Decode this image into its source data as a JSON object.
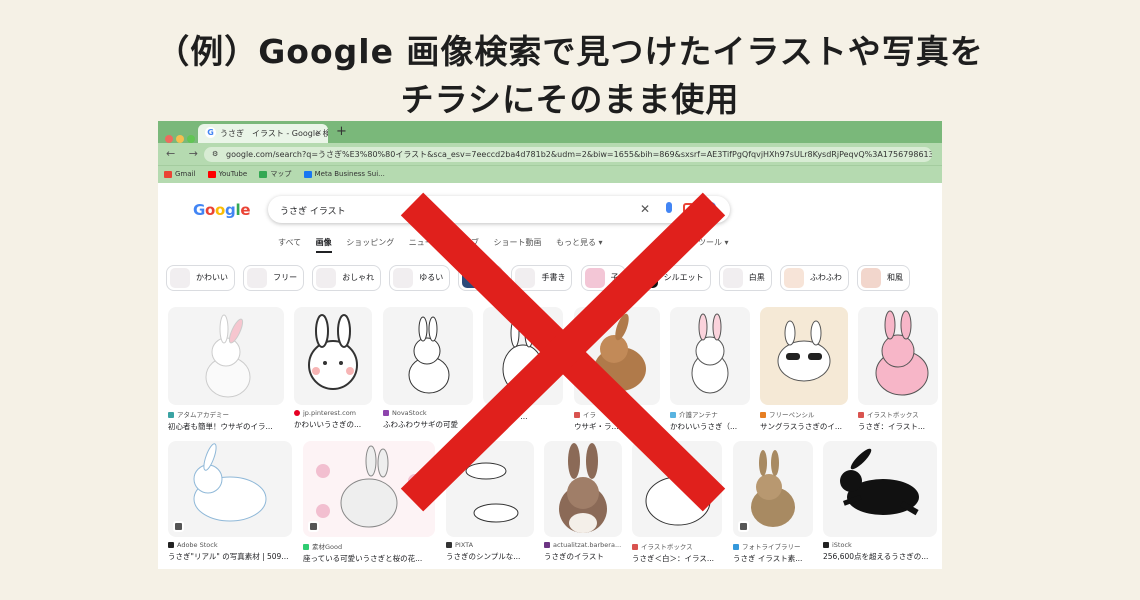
{
  "headline": {
    "line1": "（例）Google 画像検索で見つけたイラストや写真を",
    "line2": "チラシにそのまま使用"
  },
  "browser": {
    "tab_title": "うさぎ　イラスト - Google 検索",
    "tab_close": "×",
    "new_tab": "+",
    "nav_icons": "← → C",
    "url": "google.com/search?q=うさぎ%E3%80%80イラスト&sca_esv=7eeccd2ba4d781b2&udm=2&biw=1655&bih=869&sxsrf=AE3TifPgQfqvjHXh97sULr8KysdRjPeqvQ%3A1756798613870&ei=lZ62aOPoNJ...",
    "bookmarks": [
      "Gmail",
      "YouTube",
      "マップ",
      "Meta Business Sui..."
    ]
  },
  "google": {
    "logo": [
      "G",
      "o",
      "o",
      "g",
      "l",
      "e"
    ],
    "logo_colors": [
      "#4285f4",
      "#ea4335",
      "#fbbc05",
      "#4285f4",
      "#34a853",
      "#ea4335"
    ],
    "query": "うさぎ イラスト",
    "clear_icon": "✕",
    "tabs": [
      "すべて",
      "画像",
      "ショッピング",
      "ニュース",
      "ウェブ",
      "ショート動画",
      "もっと見る ▾"
    ],
    "tools": "ツール ▾",
    "chips": [
      "かわいい",
      "フリー",
      "おしゃれ",
      "ゆるい",
      "い",
      "手書き",
      "子",
      "シルエット",
      "白黒",
      "ふわふわ",
      "和風"
    ]
  },
  "results_row1": [
    {
      "source": "アタムアカデミー",
      "caption": "初心者も簡単！ウサギのイラ..."
    },
    {
      "source": "jp.pinterest.com",
      "caption": "かわいいうさぎの..."
    },
    {
      "source": "NovaStock",
      "caption": "ふわふわウサギの可愛"
    },
    {
      "source": "",
      "caption": "のイラスト..."
    },
    {
      "source": "イラ",
      "caption": "ウサギ・ラ..."
    },
    {
      "source": "介護アンテナ",
      "caption": "かわいいうさぎ（..."
    },
    {
      "source": "フリーペンシル",
      "caption": "サングラスうさぎのイ..."
    },
    {
      "source": "イラストボックス",
      "caption": "うさぎ：イラスト..."
    }
  ],
  "results_row2": [
    {
      "source": "Adobe Stock",
      "caption": "うさぎ\"リアル\" の写真素材 | 509..."
    },
    {
      "source": "素材Good",
      "caption": "座っている可愛いうさぎと桜の花..."
    },
    {
      "source": "PIXTA",
      "caption": "うさぎのシンプルな..."
    },
    {
      "source": "actualitzat.barbera...",
      "caption": "うさぎのイラスト"
    },
    {
      "source": "イラストボックス",
      "caption": "うさぎ＜白＞：イラス..."
    },
    {
      "source": "フォトライブラリー",
      "caption": "うさぎ イラスト素..."
    },
    {
      "source": "iStock",
      "caption": "256,600点を超えるうさぎの..."
    }
  ],
  "colors": {
    "background": "#f5f1e6",
    "browser_chrome": "#7ab87a",
    "cross": "#e0201c"
  }
}
